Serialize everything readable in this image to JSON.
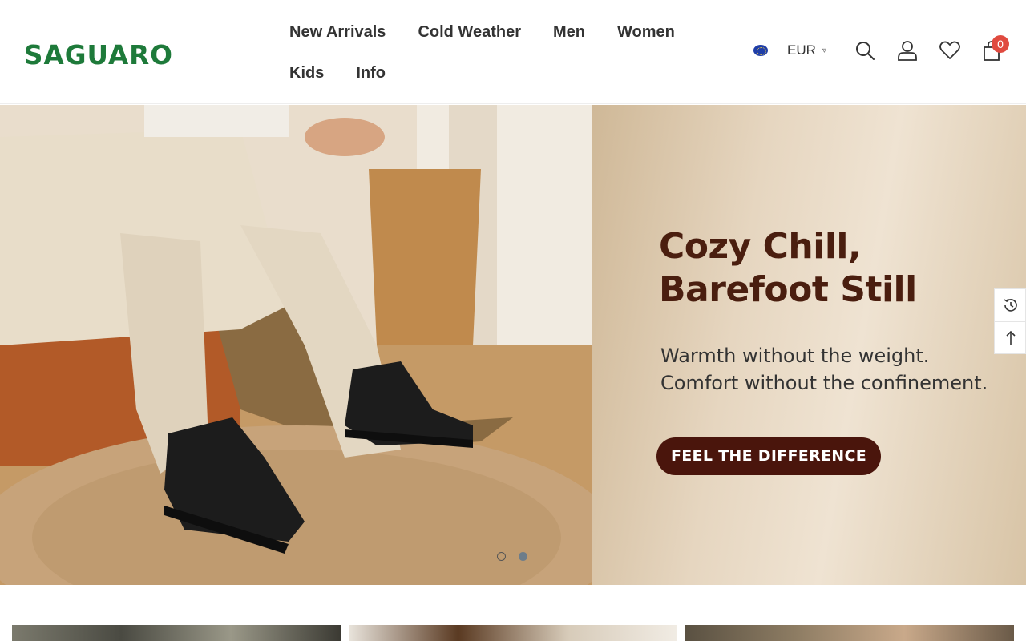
{
  "brand": {
    "logo_text": "SAGUARO",
    "color": "#1e7a3a"
  },
  "nav": {
    "row1": [
      "New Arrivals",
      "Cold Weather",
      "Men",
      "Women"
    ],
    "row2": [
      "Kids",
      "Info"
    ]
  },
  "currency": {
    "flag": "eu-flag-icon",
    "label": "EUR"
  },
  "header_icons": [
    "search-icon",
    "account-icon",
    "wishlist-icon",
    "cart-icon"
  ],
  "cart": {
    "count": "0"
  },
  "hero": {
    "title_line1": "Cozy Chill,",
    "title_line2": "Barefoot Still",
    "subtitle_line1": "Warmth without the weight.",
    "subtitle_line2": "Comfort without the confinement.",
    "cta_label": "FEEL THE DIFFERENCE",
    "slides": {
      "count": 2,
      "active": 2
    }
  },
  "side_tools": [
    "recently-viewed-icon",
    "back-to-top-icon"
  ],
  "colors": {
    "accent": "#1e7a3a",
    "cta": "#4a150c",
    "badge": "#e04a3f",
    "headline": "#4a1e0f"
  }
}
